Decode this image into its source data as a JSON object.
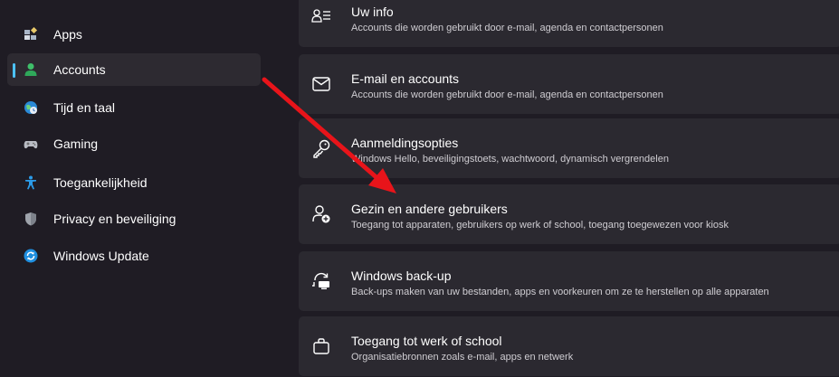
{
  "sidebar": {
    "items": [
      {
        "label": "Apps",
        "icon": "apps-icon"
      },
      {
        "label": "Accounts",
        "icon": "accounts-icon",
        "active": true
      },
      {
        "label": "Tijd en taal",
        "icon": "globe-clock-icon"
      },
      {
        "label": "Gaming",
        "icon": "gamepad-icon"
      },
      {
        "label": "Toegankelijkheid",
        "icon": "accessibility-icon"
      },
      {
        "label": "Privacy en beveiliging",
        "icon": "shield-icon"
      },
      {
        "label": "Windows Update",
        "icon": "update-icon"
      }
    ]
  },
  "cards": [
    {
      "title": "Uw info",
      "desc": "Accounts die worden gebruikt door e-mail, agenda en contactpersonen",
      "icon": "user-info-icon"
    },
    {
      "title": "E-mail en accounts",
      "desc": "Accounts die worden gebruikt door e-mail, agenda en contactpersonen",
      "icon": "mail-icon"
    },
    {
      "title": "Aanmeldingsopties",
      "desc": "Windows Hello, beveiligingstoets, wachtwoord, dynamisch vergrendelen",
      "icon": "key-icon"
    },
    {
      "title": "Gezin en andere gebruikers",
      "desc": "Toegang tot apparaten, gebruikers op werk of school, toegang toegewezen voor kiosk",
      "icon": "add-user-icon"
    },
    {
      "title": "Windows back-up",
      "desc": "Back-ups maken van uw bestanden, apps en voorkeuren om ze te herstellen op alle apparaten",
      "icon": "backup-icon"
    },
    {
      "title": "Toegang tot werk of school",
      "desc": "Organisatiebronnen zoals e-mail, apps en netwerk",
      "icon": "briefcase-icon"
    }
  ],
  "colors": {
    "accent": "#4cc2ff",
    "arrow": "#e8141a",
    "background": "#1f1c24",
    "card": "#2b2930"
  }
}
